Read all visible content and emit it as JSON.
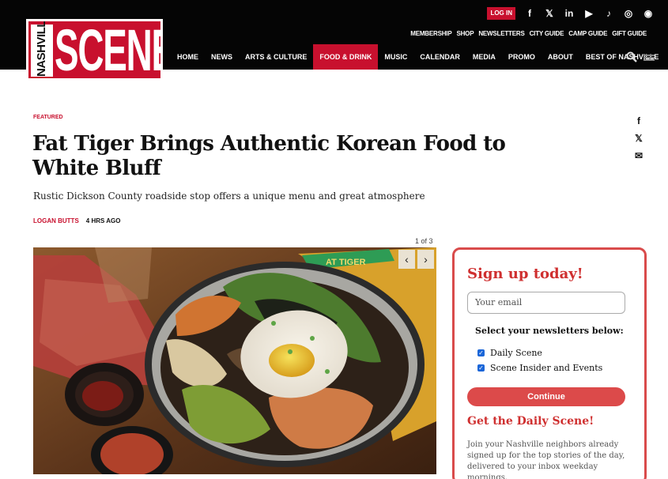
{
  "site": {
    "logo_side": "NASHVILLE",
    "logo_main": "SCENE"
  },
  "header": {
    "login_label": "LOG IN",
    "social_icons": [
      "facebook-icon",
      "x-icon",
      "linkedin-icon",
      "youtube-icon",
      "tiktok-icon",
      "instagram-icon",
      "podcast-icon"
    ],
    "social_glyphs": {
      "facebook": "f",
      "x": "𝕏",
      "linkedin": "in",
      "youtube": "▶",
      "tiktok": "♪",
      "instagram": "◎",
      "podcast": "◉"
    },
    "utility_links": [
      "MEMBERSHIP",
      "SHOP",
      "NEWSLETTERS",
      "CITY GUIDE",
      "CAMP GUIDE",
      "GIFT GUIDE"
    ],
    "nav_items": [
      "HOME",
      "NEWS",
      "ARTS & CULTURE",
      "FOOD & DRINK",
      "MUSIC",
      "CALENDAR",
      "MEDIA",
      "PROMO",
      "ABOUT",
      "BEST OF NASHVILLE"
    ],
    "active_nav": "FOOD & DRINK"
  },
  "article": {
    "kicker": "FEATURED",
    "title": "Fat Tiger Brings Authentic Korean Food to White Bluff",
    "dek": "Rustic Dickson County roadside stop offers a unique menu and great atmosphere",
    "author": "LOGAN BUTTS",
    "time": "4 HRS AGO",
    "image_counter": "1 of 3",
    "sign_text": "AT TIGER"
  },
  "share": {
    "facebook": "f",
    "x": "𝕏",
    "email": "✉"
  },
  "signup": {
    "heading": "Sign up today!",
    "email_placeholder": "Your email",
    "select_prompt": "Select your newsletters below:",
    "option_1": "Daily Scene",
    "option_2": "Scene Insider and Events",
    "continue_label": "Continue",
    "daily_heading": "Get the Daily Scene!",
    "daily_text": "Join your Nashville neighbors already signed up for the top stories of the day, delivered to your inbox weekday mornings."
  },
  "colors": {
    "brand_red": "#c8102e",
    "signup_red": "#cf2f2f",
    "checkbox_blue": "#1b66d8",
    "header_black": "#050505"
  }
}
